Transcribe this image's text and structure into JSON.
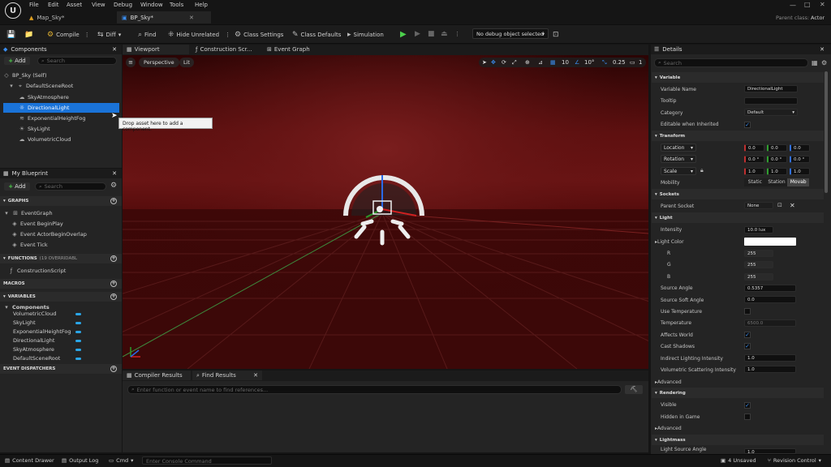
{
  "menu": [
    "File",
    "Edit",
    "Asset",
    "View",
    "Debug",
    "Window",
    "Tools",
    "Help"
  ],
  "tabs": [
    {
      "label": "Map_Sky*"
    },
    {
      "label": "BP_Sky*"
    }
  ],
  "parent_class": {
    "label": "Parent class:",
    "value": "Actor"
  },
  "toolbar": {
    "compile": "Compile",
    "diff": "Diff",
    "find": "Find",
    "hide_unrelated": "Hide Unrelated",
    "class_settings": "Class Settings",
    "class_defaults": "Class Defaults",
    "simulation": "Simulation",
    "debug_object": "No debug object selected"
  },
  "components": {
    "title": "Components",
    "add": "Add",
    "search_placeholder": "Search",
    "items": [
      {
        "label": "BP_Sky (Self)"
      },
      {
        "label": "DefaultSceneRoot"
      },
      {
        "label": "SkyAtmosphere"
      },
      {
        "label": "DirectionalLight"
      },
      {
        "label": "ExponentialHeightFog"
      },
      {
        "label": "SkyLight"
      },
      {
        "label": "VolumetricCloud"
      }
    ],
    "tooltip": "Drop asset here to add a component."
  },
  "my_blueprint": {
    "title": "My Blueprint",
    "add": "Add",
    "search_placeholder": "Search",
    "graphs": "GRAPHS",
    "event_graph": "EventGraph",
    "events": [
      "Event BeginPlay",
      "Event ActorBeginOverlap",
      "Event Tick"
    ],
    "functions": "FUNCTIONS",
    "functions_count": "(19 OVERRIDABL",
    "construction_script": "ConstructionScript",
    "macros": "MACROS",
    "variables": "VARIABLES",
    "components_cat": "Components",
    "vars": [
      "VolumetricCloud",
      "SkyLight",
      "ExponentialHeightFog",
      "DirectionalLight",
      "SkyAtmosphere",
      "DefaultSceneRoot"
    ],
    "event_dispatchers": "EVENT DISPATCHERS"
  },
  "center_tabs": [
    "Viewport",
    "Construction Scr...",
    "Event Graph"
  ],
  "viewport": {
    "perspective": "Perspective",
    "lit": "Lit",
    "grid": "10",
    "angle": "10°",
    "scale": "0.25",
    "cameras": "1"
  },
  "bottom": {
    "tabs": [
      "Compiler Results",
      "Find Results"
    ],
    "search_placeholder": "Enter function or event name to find references..."
  },
  "details": {
    "title": "Details",
    "search_placeholder": "Search",
    "sections": {
      "variable": "Variable",
      "transform": "Transform",
      "sockets": "Sockets",
      "light": "Light",
      "rendering": "Rendering",
      "lightmass": "Lightmass"
    },
    "variable_name_label": "Variable Name",
    "variable_name": "DirectionalLight",
    "tooltip_label": "Tooltip",
    "category_label": "Category",
    "category": "Default",
    "editable_label": "Editable when Inherited",
    "location": "Location",
    "rotation": "Rotation",
    "scale": "Scale",
    "loc": [
      "0.0",
      "0.0",
      "0.0"
    ],
    "rot": [
      "0.0 °",
      "0.0 °",
      "0.0 °"
    ],
    "scl": [
      "1.0",
      "1.0",
      "1.0"
    ],
    "mobility_label": "Mobility",
    "mobility": [
      "Static",
      "Station",
      "Movab"
    ],
    "parent_socket_label": "Parent Socket",
    "parent_socket": "None",
    "intensity_label": "Intensity",
    "intensity": "10.0 lux",
    "light_color_label": "Light Color",
    "r": "R",
    "g": "G",
    "b": "B",
    "rv": "255",
    "gv": "255",
    "bv": "255",
    "source_angle_label": "Source Angle",
    "source_angle": "0.5357",
    "soft_angle_label": "Source Soft Angle",
    "soft_angle": "0.0",
    "use_temp_label": "Use Temperature",
    "temp_label": "Temperature",
    "temp": "6500.0",
    "affects_world_label": "Affects World",
    "cast_shadows_label": "Cast Shadows",
    "indirect_label": "Indirect Lighting Intensity",
    "indirect": "1.0",
    "volumetric_label": "Volumetric Scattering Intensity",
    "volumetric": "1.0",
    "advanced": "Advanced",
    "visible_label": "Visible",
    "hidden_label": "Hidden in Game",
    "lightmass_angle_label": "Light Source Angle",
    "lightmass_angle": "1.0"
  },
  "status": {
    "content_drawer": "Content Drawer",
    "output_log": "Output Log",
    "cmd": "Cmd",
    "console_placeholder": "Enter Console Command",
    "unsaved": "4 Unsaved",
    "revision": "Revision Control"
  },
  "colors": {
    "accent": "#1a73d8",
    "bg": "#242424",
    "viewport": "#5e1010"
  }
}
